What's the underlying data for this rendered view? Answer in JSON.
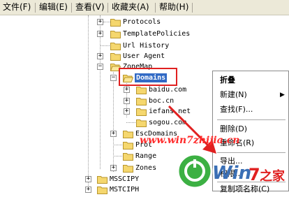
{
  "menubar": {
    "items": [
      "文件(F)",
      "编辑(E)",
      "查看(V)",
      "收藏夹(A)",
      "帮助(H)"
    ]
  },
  "tree": {
    "nodes": {
      "protocols": "Protocols",
      "template_policies": "TemplatePolicies",
      "url_history": "Url History",
      "user_agent": "User Agent",
      "zonemap": "ZoneMap",
      "domains": "Domains",
      "baidu": "baidu.com",
      "boc": "boc.cn",
      "iefans": "iefans.net",
      "sogou": "sogou.com",
      "esc_domains": "EscDomains",
      "protocol_defaults": "Prot",
      "ranges": "Range",
      "zones": "Zones",
      "msscipy": "MSSCIPY",
      "mstciph": "MSTCIPH"
    },
    "selected": "Domains"
  },
  "context_menu": {
    "items": [
      {
        "label": "折叠",
        "bold": true
      },
      {
        "label": "新建(N)",
        "submenu": true
      },
      {
        "label": "查找(F)..."
      },
      {
        "label": "删除(D)"
      },
      {
        "label": "重命名(R)"
      },
      {
        "label": "导出..."
      },
      {
        "label": "权限..."
      },
      {
        "label": "复制项名称(C)"
      }
    ]
  },
  "watermark": {
    "site": "www.win7zhijia.cn",
    "logo_text": "Win7之家"
  },
  "colors": {
    "menubar_bg": "#ece9d8",
    "selection": "#316ac5",
    "highlight_box": "#e02020",
    "folder": "#f5d76e",
    "logo_green": "#3cb043"
  }
}
